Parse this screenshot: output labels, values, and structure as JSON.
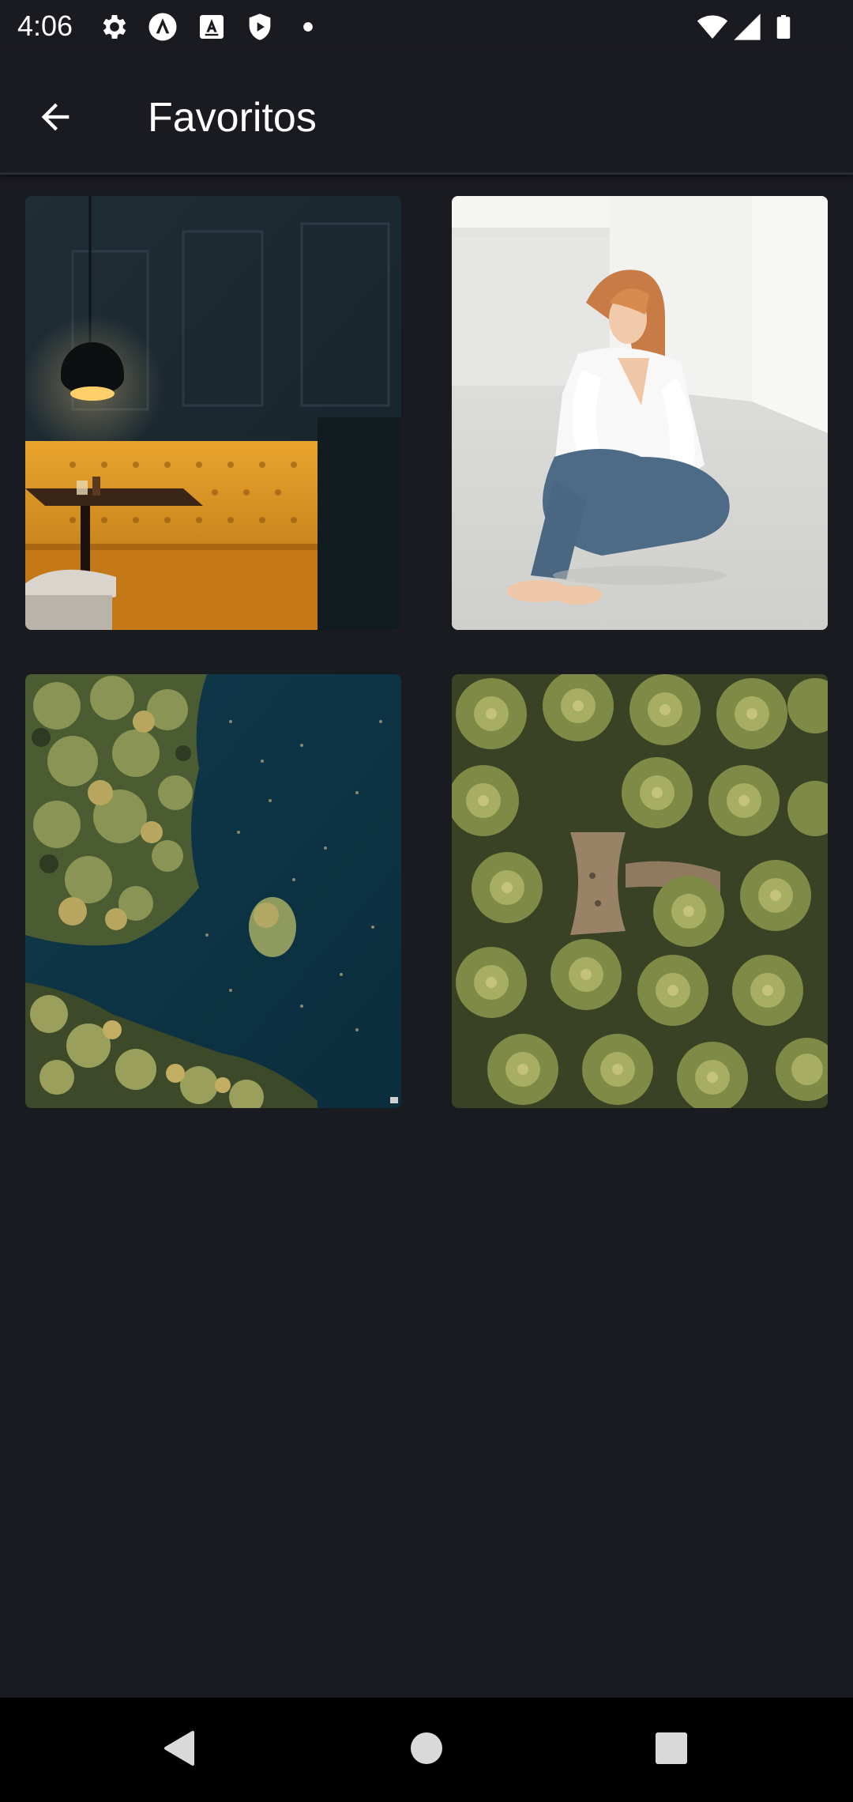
{
  "status_bar": {
    "time": "4:06",
    "left_icons": [
      "gear-icon",
      "android-studio-icon",
      "keyboard-a-icon",
      "shield-play-icon",
      "dot-icon"
    ],
    "right_icons": [
      "wifi-icon",
      "signal-icon",
      "battery-icon"
    ]
  },
  "app_bar": {
    "title": "Favoritos",
    "back_icon": "arrow-back-icon"
  },
  "favorites": [
    {
      "subject": "restaurant-booth"
    },
    {
      "subject": "woman-sitting"
    },
    {
      "subject": "aerial-forest-lake"
    },
    {
      "subject": "aerial-palm-trees"
    }
  ],
  "nav_bar": {
    "icons": [
      "nav-back-icon",
      "nav-home-icon",
      "nav-recents-icon"
    ]
  },
  "colors": {
    "background": "#1a1b21",
    "app_bar": "#1a1b21",
    "nav_bar": "#000000",
    "text": "#ffffff"
  }
}
